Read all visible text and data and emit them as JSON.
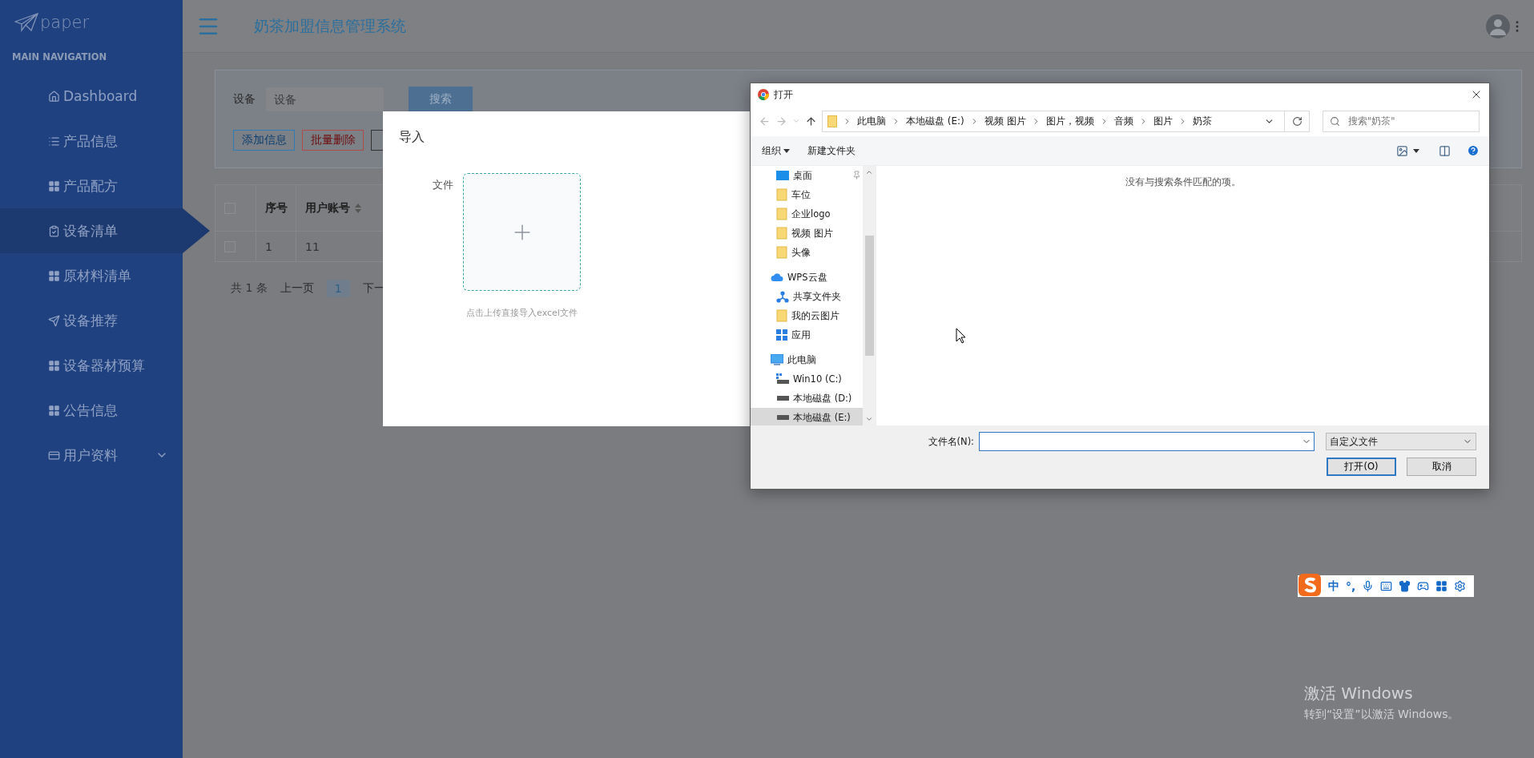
{
  "sidebar": {
    "logo": "paper",
    "section_title": "MAIN NAVIGATION",
    "items": [
      {
        "label": "Dashboard",
        "kind": "home",
        "selected": false,
        "has_submenu": false
      },
      {
        "label": "产品信息",
        "kind": "list",
        "selected": false,
        "has_submenu": false
      },
      {
        "label": "产品配方",
        "kind": "grid",
        "selected": false,
        "has_submenu": false
      },
      {
        "label": "设备清单",
        "kind": "clipboard",
        "selected": true,
        "has_submenu": false
      },
      {
        "label": "原材料清单",
        "kind": "grid",
        "selected": false,
        "has_submenu": false
      },
      {
        "label": "设备推荐",
        "kind": "send",
        "selected": false,
        "has_submenu": false
      },
      {
        "label": "设备器材预算",
        "kind": "grid",
        "selected": false,
        "has_submenu": false
      },
      {
        "label": "公告信息",
        "kind": "grid",
        "selected": false,
        "has_submenu": false
      },
      {
        "label": "用户资料",
        "kind": "card",
        "selected": false,
        "has_submenu": true
      }
    ]
  },
  "header": {
    "title": "奶茶加盟信息管理系统"
  },
  "search_panel": {
    "label": "设备",
    "placeholder": "设备",
    "search_button": "搜索",
    "actions": [
      {
        "label": "添加信息",
        "kind": "primary"
      },
      {
        "label": "批量删除",
        "kind": "danger"
      },
      {
        "kind": "default"
      }
    ]
  },
  "table": {
    "header_checked": false,
    "columns": [
      {
        "label": "序号",
        "sortable": false
      },
      {
        "label": "用户账号",
        "sortable": true
      }
    ],
    "rows": [
      {
        "checked": false,
        "cells": [
          "1",
          "11"
        ]
      }
    ]
  },
  "pagination": {
    "total": "共 1 条",
    "prev": "上一页",
    "pages": [
      {
        "label": "1",
        "selected": true
      }
    ],
    "next": "下一"
  },
  "import_dialog": {
    "title": "导入",
    "field_label": "文件",
    "hint": "点击上传直接导入excel文件"
  },
  "file_dialog": {
    "title": "打开",
    "path": [
      "此电脑",
      "本地磁盘 (E:)",
      "视频 图片",
      "图片，视频",
      "音频",
      "图片",
      "奶茶"
    ],
    "search_placeholder": "搜索\"奶茶\"",
    "toolbar": {
      "organize": "组织",
      "new_folder": "新建文件夹"
    },
    "tree": [
      {
        "label": "桌面",
        "kind": "desktop",
        "pinned": true,
        "selected": false
      },
      {
        "label": "车位",
        "kind": "folder",
        "pinned": false,
        "selected": false
      },
      {
        "label": "企业logo",
        "kind": "folder",
        "pinned": false,
        "selected": false
      },
      {
        "label": "视频 图片",
        "kind": "folder",
        "pinned": false,
        "selected": false
      },
      {
        "label": "头像",
        "kind": "folder",
        "pinned": false,
        "selected": false
      },
      {
        "label": "WPS云盘",
        "kind": "cloud",
        "pinned": false,
        "selected": false,
        "children": [
          {
            "label": "共享文件夹",
            "kind": "share",
            "pinned": false,
            "selected": false
          },
          {
            "label": "我的云图片",
            "kind": "folder",
            "pinned": false,
            "selected": false
          },
          {
            "label": "应用",
            "kind": "apps",
            "pinned": false,
            "selected": false
          }
        ]
      },
      {
        "label": "此电脑",
        "kind": "computer",
        "pinned": false,
        "selected": false,
        "children": [
          {
            "label": "Win10 (C:)",
            "kind": "system_drive",
            "pinned": false,
            "selected": false
          },
          {
            "label": "本地磁盘 (D:)",
            "kind": "drive",
            "pinned": false,
            "selected": false
          },
          {
            "label": "本地磁盘 (E:)",
            "kind": "drive",
            "pinned": false,
            "selected": true
          }
        ]
      }
    ],
    "empty_message": "没有与搜索条件匹配的项。",
    "filename_label": "文件名(N):",
    "file_type": "自定义文件",
    "buttons": [
      {
        "label": "打开(O)",
        "kind": "primary"
      },
      {
        "label": "取消",
        "kind": "default"
      }
    ]
  },
  "ime_toolbar": {
    "items": [
      {
        "kind": "logo"
      },
      {
        "kind": "text",
        "label": "中"
      },
      {
        "kind": "text",
        "label": "°,"
      },
      {
        "kind": "mic"
      },
      {
        "kind": "keyboard"
      },
      {
        "kind": "shirt"
      },
      {
        "kind": "gamepad"
      },
      {
        "kind": "apps"
      },
      {
        "kind": "gear"
      }
    ]
  },
  "activation_notice": {
    "title": "激活 Windows",
    "text": "转到“设置”以激活 Windows。"
  }
}
